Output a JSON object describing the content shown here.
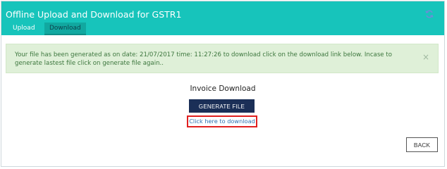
{
  "header": {
    "title": "Offline Upload and Download for GSTR1",
    "tabs": [
      {
        "label": "Upload"
      },
      {
        "label": "Download"
      }
    ],
    "refresh_icon": "refresh-icon",
    "color": "#17c4bb"
  },
  "alert": {
    "message": "Your file has been generated as on date: 21/07/2017 time: 11:27:26 to download click on the download link below. Incase to generate lastest file click on generate file again..",
    "close_symbol": "×",
    "close_icon": "close-icon"
  },
  "main": {
    "section_title": "Invoice Download",
    "generate_button": "GENERATE FILE",
    "download_link": "Click here to download",
    "back_button": "BACK"
  },
  "colors": {
    "header": "#17c4bb",
    "primary_button": "#1b2f57",
    "alert_background": "#dff0d8",
    "link": "#2a6fb0",
    "highlight": "#e02020"
  }
}
